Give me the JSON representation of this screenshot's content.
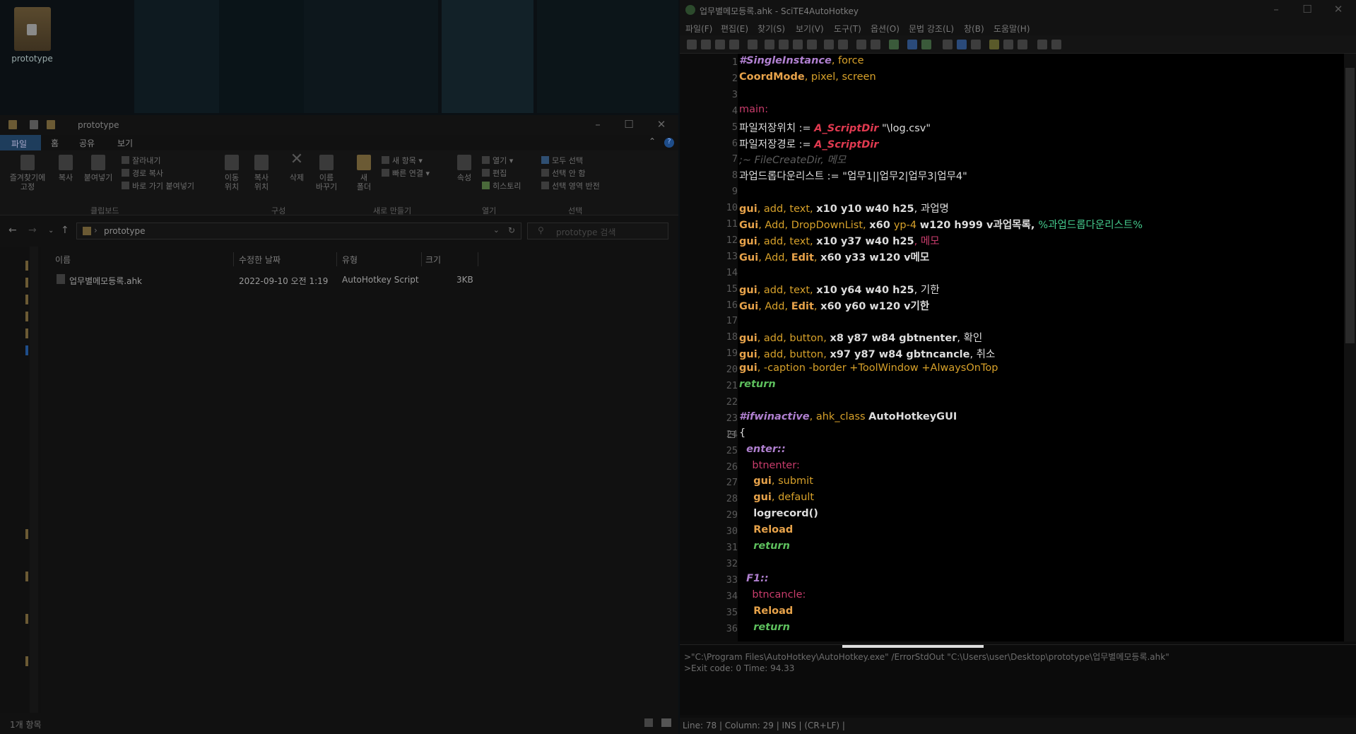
{
  "desktop": {
    "icon_label": "prototype"
  },
  "explorer": {
    "title": "prototype",
    "tabs": [
      "파일",
      "홈",
      "공유",
      "보기"
    ],
    "ribbon": {
      "pin": "즐겨찾기에\n고정",
      "copy": "복사",
      "paste": "붙여넣기",
      "cut": "잘라내기",
      "copy_path": "경로 복사",
      "paste_shortcut": "바로 가기 붙여넣기",
      "move_to": "이동\n위치",
      "copy_to": "복사\n위치",
      "delete": "삭제",
      "rename": "이름\n바꾸기",
      "new_folder": "새\n폴더",
      "new_item": "새 항목",
      "easy_access": "빠른 연결",
      "properties": "속성",
      "open": "열기",
      "edit": "편집",
      "history": "히스토리",
      "select_all": "모두 선택",
      "select_none": "선택 안 함",
      "invert_selection": "선택 영역 반전",
      "groups": [
        "클립보드",
        "구성",
        "새로 만들기",
        "열기",
        "선택"
      ]
    },
    "address": "prototype",
    "search_placeholder": "prototype 검색",
    "columns": [
      "이름",
      "수정한 날짜",
      "유형",
      "크기"
    ],
    "files": [
      {
        "name": "업무별메모등록.ahk",
        "date": "2022-09-10 오전 1:19",
        "type": "AutoHotkey Script",
        "size": "3KB"
      }
    ],
    "status": "1개 항목"
  },
  "scite": {
    "title": "업무별메모등록.ahk - SciTE4AutoHotkey",
    "menu": [
      "파일(F)",
      "편집(E)",
      "찾기(S)",
      "보기(V)",
      "도구(T)",
      "옵션(O)",
      "문법 강조(L)",
      "창(B)",
      "도움말(H)"
    ],
    "output": [
      ">\"C:\\Program Files\\AutoHotkey\\AutoHotkey.exe\" /ErrorStdOut \"C:\\Users\\user\\Desktop\\prototype\\업무별메모등록.ahk\"",
      ">Exit code: 0    Time: 94.33"
    ],
    "status": "Line: 78 | Column: 29 | INS | (CR+LF) |"
  }
}
